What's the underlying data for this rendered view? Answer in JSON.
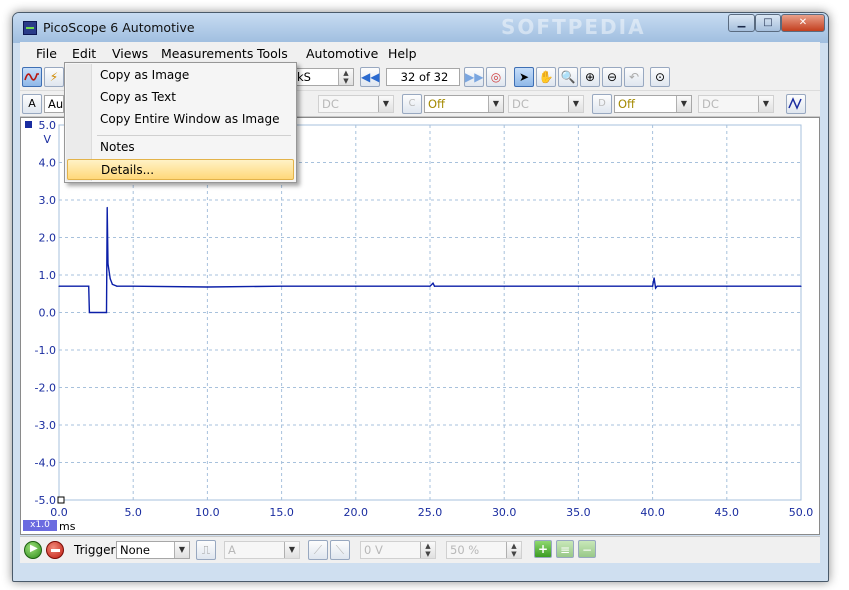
{
  "window": {
    "title": "PicoScope 6 Automotive",
    "watermark": "SOFTPEDIA"
  },
  "window_buttons": {
    "minimize": "▁",
    "maximize": "□",
    "close": "✕"
  },
  "menu": [
    {
      "label": "File"
    },
    {
      "label": "Edit"
    },
    {
      "label": "Views"
    },
    {
      "label": "Measurements"
    },
    {
      "label": "Tools"
    },
    {
      "label": "Automotive"
    },
    {
      "label": "Help"
    }
  ],
  "toolbar": {
    "samples_value": "0 kS",
    "buffer_position": "32 of 32"
  },
  "channels": {
    "a_label": "A",
    "a_range": "Au",
    "a_coupling": "DC",
    "c_label": "C",
    "c_range": "Off",
    "c_coupling": "DC",
    "d_label": "D",
    "d_range": "Off",
    "d_coupling": "DC"
  },
  "edit_menu": {
    "items": [
      {
        "label": "Copy as Image"
      },
      {
        "label": "Copy as Text"
      },
      {
        "label": "Copy Entire Window as Image"
      },
      {
        "label": "Notes"
      },
      {
        "label": "Details..."
      }
    ],
    "highlighted": "Details..."
  },
  "scope": {
    "y_unit": "V",
    "x_unit": "ms",
    "zoom": "x1.0",
    "y_ticks": [
      "5.0",
      "4.0",
      "3.0",
      "2.0",
      "1.0",
      "0.0",
      "-1.0",
      "-2.0",
      "-3.0",
      "-4.0",
      "-5.0"
    ],
    "x_ticks": [
      "0.0",
      "5.0",
      "10.0",
      "15.0",
      "20.0",
      "25.0",
      "30.0",
      "35.0",
      "40.0",
      "45.0",
      "50.0"
    ]
  },
  "chart_data": {
    "type": "line",
    "title": "",
    "xlabel": "ms",
    "ylabel": "V",
    "xlim": [
      0,
      50
    ],
    "ylim": [
      -5,
      5
    ],
    "grid": true,
    "series": [
      {
        "name": "",
        "color": "#0b1fa8",
        "x": [
          0,
          2.0,
          2.05,
          3.2,
          3.25,
          3.3,
          3.45,
          3.6,
          3.9,
          5,
          10,
          15,
          20,
          25,
          25.2,
          25.3,
          30,
          35,
          40,
          40.1,
          40.2,
          40.3,
          45,
          50
        ],
        "y": [
          0.7,
          0.7,
          0.0,
          0.0,
          2.8,
          1.3,
          0.9,
          0.75,
          0.7,
          0.7,
          0.68,
          0.7,
          0.7,
          0.7,
          0.78,
          0.7,
          0.7,
          0.7,
          0.7,
          0.92,
          0.65,
          0.7,
          0.7,
          0.7
        ]
      }
    ]
  },
  "trigger": {
    "label": "Trigger",
    "mode": "None",
    "source": "A",
    "threshold": "0 V",
    "pretrigger": "50 %"
  }
}
